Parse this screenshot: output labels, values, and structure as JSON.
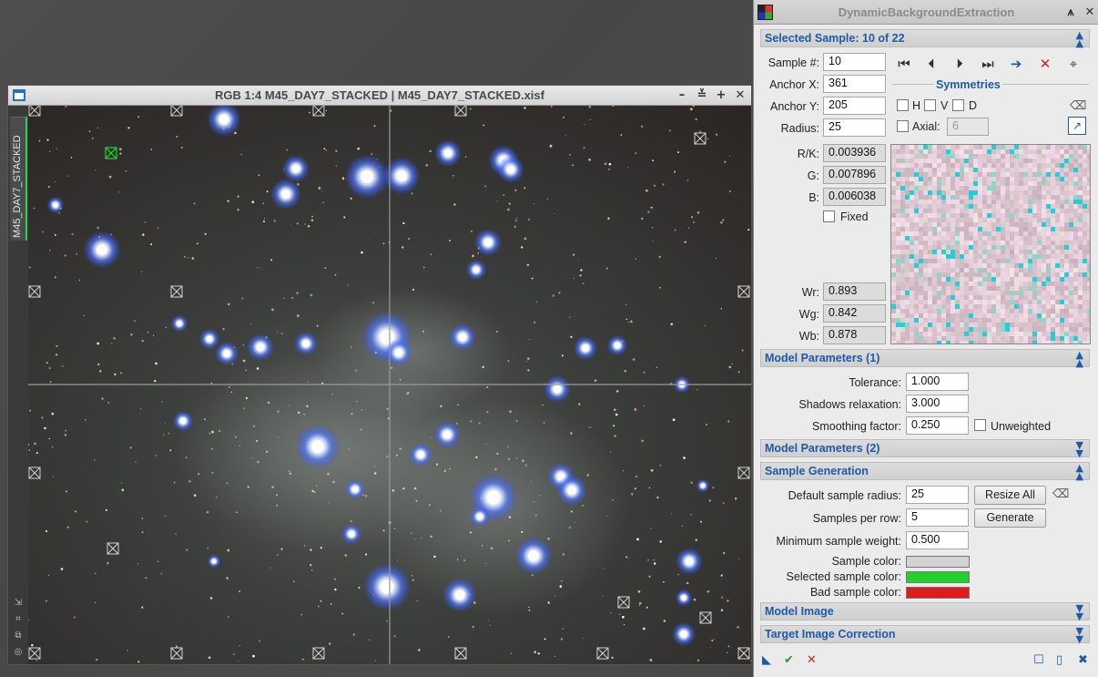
{
  "image_window": {
    "title": "RGB 1:4 M45_DAY7_STACKED | M45_DAY7_STACKED.xisf",
    "view_tab": "M45_DAY7_STACKED",
    "buttons": {
      "minimize": "–",
      "shade": "≚",
      "maximize": "+",
      "close": "✕"
    }
  },
  "dbe": {
    "title": "DynamicBackgroundExtraction",
    "selected_sample": {
      "header": "Selected Sample: 10 of 22",
      "sample_label": "Sample #:",
      "sample_value": "10",
      "anchor_x_label": "Anchor X:",
      "anchor_x_value": "361",
      "anchor_y_label": "Anchor Y:",
      "anchor_y_value": "205",
      "radius_label": "Radius:",
      "radius_value": "25",
      "rk_label": "R/K:",
      "rk_value": "0.003936",
      "g_label": "G:",
      "g_value": "0.007896",
      "b_label": "B:",
      "b_value": "0.006038",
      "fixed_label": "Fixed",
      "wr_label": "Wr:",
      "wr_value": "0.893",
      "wg_label": "Wg:",
      "wg_value": "0.842",
      "wb_label": "Wb:",
      "wb_value": "0.878",
      "symmetries_label": "Symmetries",
      "h_label": "H",
      "v_label": "V",
      "d_label": "D",
      "axial_label": "Axial:",
      "axial_value": "6"
    },
    "model_params_1": {
      "header": "Model Parameters (1)",
      "tolerance_label": "Tolerance:",
      "tolerance_value": "1.000",
      "shadows_label": "Shadows relaxation:",
      "shadows_value": "3.000",
      "smoothing_label": "Smoothing factor:",
      "smoothing_value": "0.250",
      "unweighted_label": "Unweighted"
    },
    "model_params_2": {
      "header": "Model Parameters (2)"
    },
    "sample_generation": {
      "header": "Sample Generation",
      "default_radius_label": "Default sample radius:",
      "default_radius_value": "25",
      "resize_all_label": "Resize All",
      "per_row_label": "Samples per row:",
      "per_row_value": "5",
      "generate_label": "Generate",
      "min_weight_label": "Minimum sample weight:",
      "min_weight_value": "0.500",
      "sample_color_label": "Sample color:",
      "selected_color_label": "Selected sample color:",
      "bad_color_label": "Bad sample color:",
      "colors": {
        "sample": "#d2d2d2",
        "selected": "#1fd12a",
        "bad": "#e01b1b"
      }
    },
    "model_image": {
      "header": "Model Image"
    },
    "target_correction": {
      "header": "Target Image Correction"
    }
  }
}
